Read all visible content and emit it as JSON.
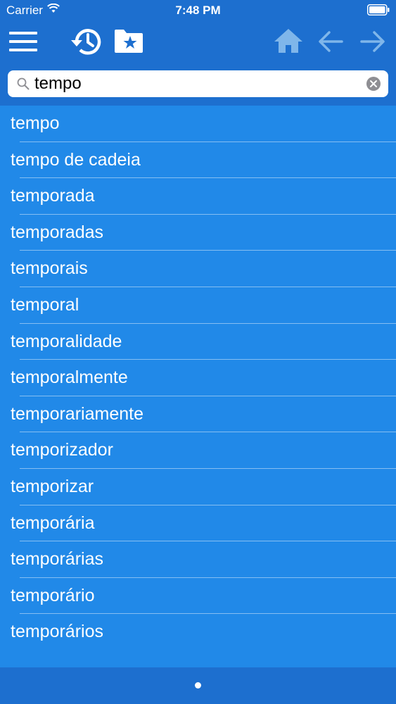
{
  "status": {
    "carrier": "Carrier",
    "time": "7:48 PM"
  },
  "toolbar": {
    "icons": [
      "menu-icon",
      "history-icon",
      "favorites-folder-icon",
      "home-icon",
      "arrow-left-icon",
      "arrow-right-icon"
    ]
  },
  "search": {
    "value": "tempo",
    "placeholder": ""
  },
  "results": [
    "tempo",
    "tempo de cadeia",
    "temporada",
    "temporadas",
    "temporais",
    "temporal",
    "temporalidade",
    "temporalmente",
    "temporariamente",
    "temporizador",
    "temporizar",
    "temporária",
    "temporárias",
    "temporário",
    "temporários"
  ],
  "colors": {
    "bar": "#1d6fcf",
    "list": "#2189e8",
    "nav_dim": "#7fb6ea"
  }
}
